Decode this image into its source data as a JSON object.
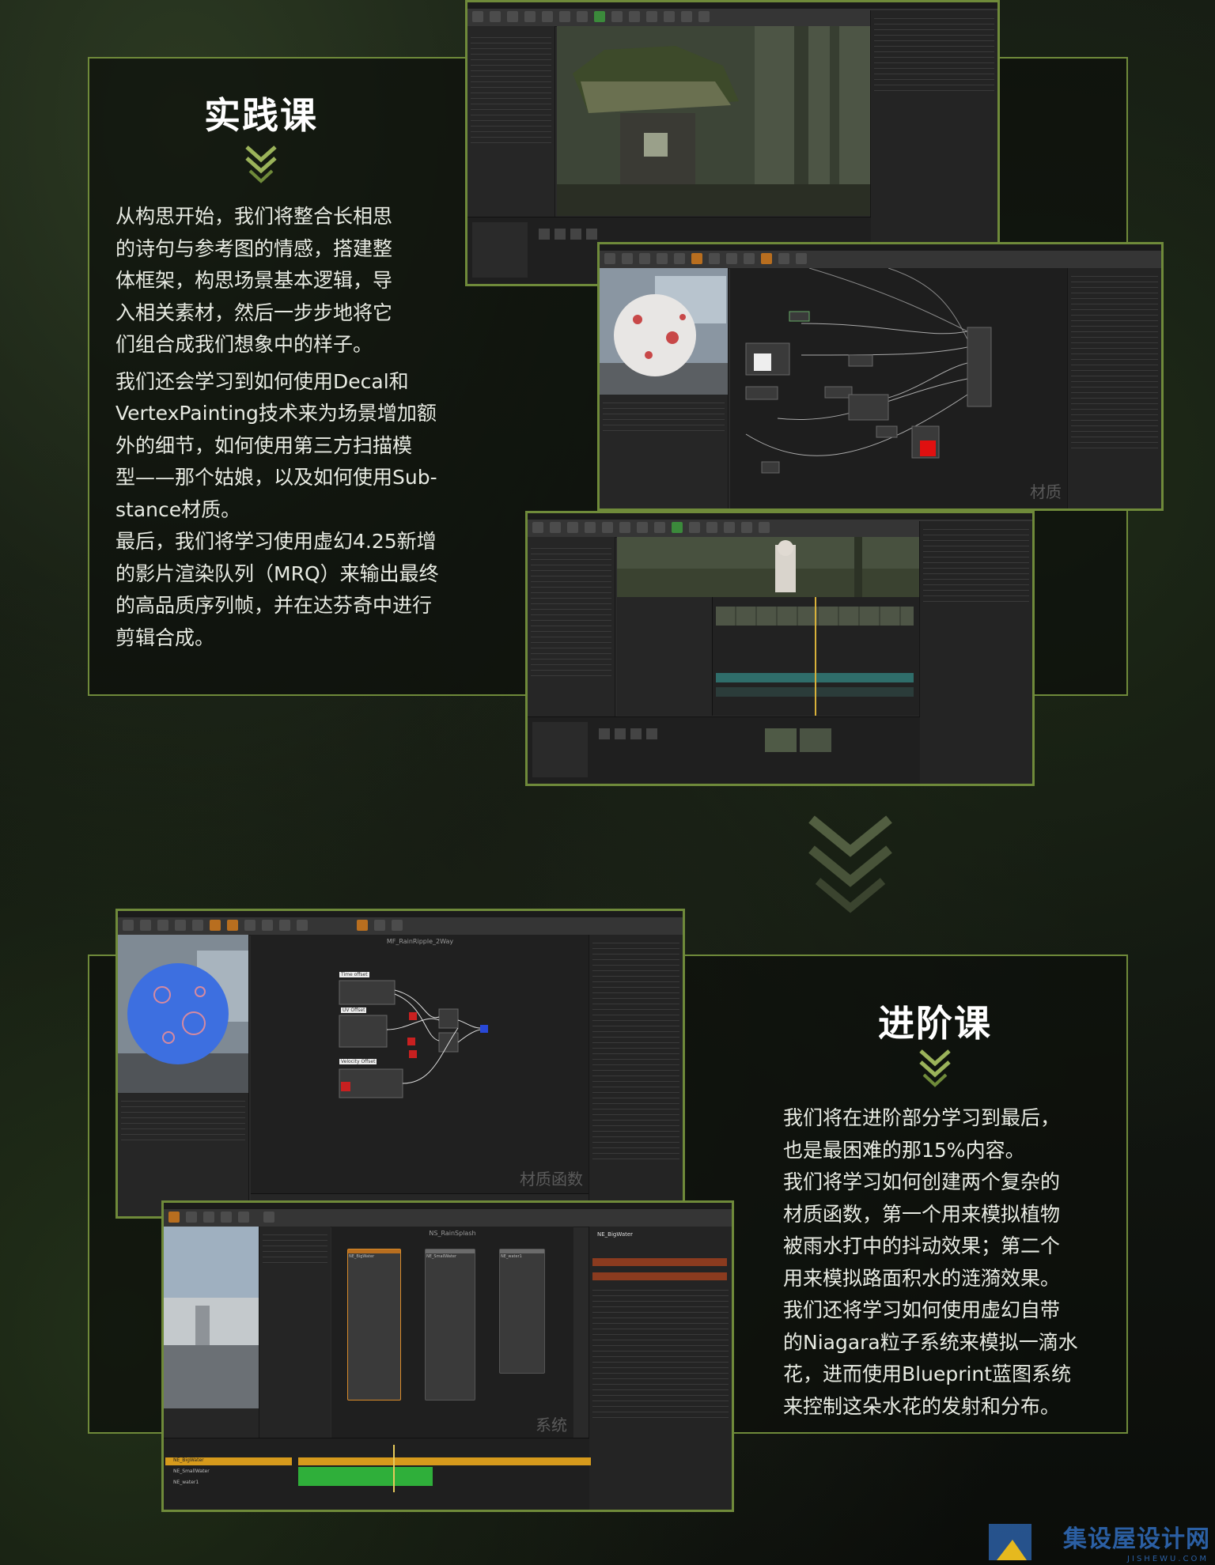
{
  "section1": {
    "title": "实践课",
    "paragraphs": [
      "从构思开始，我们将整合长相思的诗句与参考图的情感，搭建整体框架，构思场景基本逻辑，导入相关素材，然后一步步地将它们组合成我们想象中的样子。",
      "我们还会学习到如何使用Decal和VertexPainting技术来为场景增加额外的细节，如何使用第三方扫描模型——那个姑娘，以及如何使用Substance材质。",
      "最后，我们将学习使用虚幻4.25新增的影片渲染队列（MRQ）来输出最终的高品质序列帧，并在达芬奇中进行剪辑合成。"
    ],
    "lines": [
      [
        "从构思开始，我们将整合长相思",
        "的诗句与参考图的情感，搭建整",
        "体框架，构思场景基本逻辑，导",
        "入相关素材，然后一步步地将它",
        "们组合成我们想象中的样子。"
      ],
      [
        "我们还会学习到如何使用Decal和",
        "VertexPainting技术来为场景增加额",
        "外的细节，如何使用第三方扫描模",
        "型——那个姑娘，以及如何使用Sub-",
        "stance材质。"
      ],
      [
        "最后，我们将学习使用虚幻4.25新增",
        "的影片渲染队列（MRQ）来输出最终",
        "的高品质序列帧，并在达芬奇中进行",
        "剪辑合成。"
      ]
    ]
  },
  "section2": {
    "title": "进阶课",
    "lines": [
      [
        "我们将在进阶部分学习到最后，",
        "也是最困难的那15%内容。"
      ],
      [
        "我们将学习如何创建两个复杂的",
        "材质函数，第一个用来模拟植物",
        "被雨水打中的抖动效果；第二个",
        "用来模拟路面积水的涟漪效果。"
      ],
      [
        "我们还将学习如何使用虚幻自带",
        "的Niagara粒子系统来模拟一滴水",
        "花，进而使用Blueprint蓝图系统",
        "来控制这朵水花的发射和分布。"
      ]
    ]
  },
  "screenshots": {
    "material_label": "材质",
    "material_function_label": "材质函数",
    "system_label": "系统",
    "graph_title_1": "MF_RainRipple_2Way",
    "graph_title_2": "NS_RainSplash",
    "node_labels": [
      "Time offset",
      "UV Offset",
      "Velocity Offset"
    ],
    "emitters": [
      "NE_BigWater",
      "NE_SmallWater",
      "NE_water1"
    ],
    "right_panel_title": "NE_BigWater",
    "timeline_labels": [
      "NE_BigWater",
      "NE_SmallWater",
      "NE_water1"
    ]
  },
  "watermark": {
    "brand": "集设屋设计网",
    "url": "JISHEWU.COM"
  },
  "colors": {
    "accent": "#6f8a3a",
    "panel_border": "#6f8a3a",
    "chevron": "#9bb35a",
    "logo": "#2b5fa3"
  }
}
